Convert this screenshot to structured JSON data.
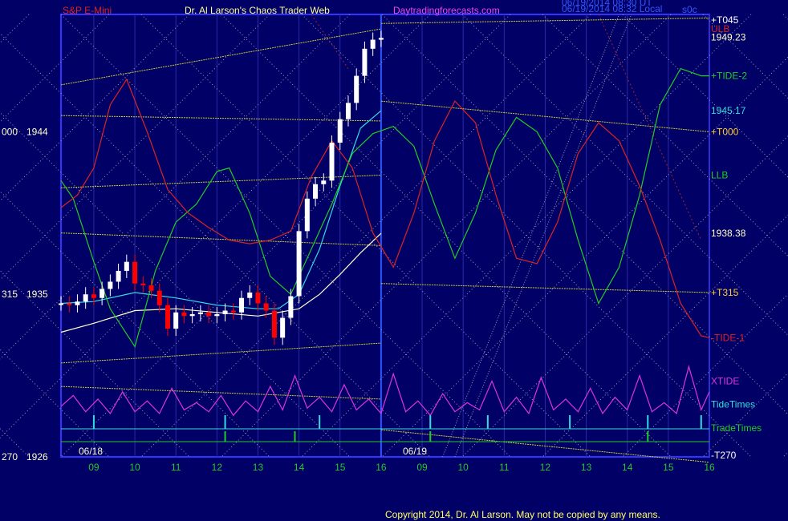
{
  "header": {
    "instrument": "S&P E-Mini",
    "site_title": "Dr. Al Larson's Chaos Trader Web",
    "site_url": "Daytradingforecasts.com",
    "timestamp_1": "06/19/2014 08:30 UT",
    "timestamp_2": "06/19/2014 08:32 Local",
    "corner_label": "s0c"
  },
  "footer": {
    "copyright": "Copyright 2014, Dr. Al Larson. May not be copied by any means."
  },
  "colors": {
    "background": "#000066",
    "plot_border": "#3333ff",
    "price_up": "#ffffff",
    "price_down": "#ff0000",
    "tide_pos": "#22cc22",
    "tide_neg": "#dd2222",
    "xtide": "#dd33dd",
    "tidetimes": "#33dddd",
    "tradetimes": "#22cc22",
    "channel": "#cccc33"
  },
  "chart_data": {
    "type": "line",
    "title": "S&P E-Mini",
    "ylim": [
      1926,
      1950.5
    ],
    "y_left_labels": [
      {
        "value": 1944,
        "text": "1944",
        "prefix": "000"
      },
      {
        "value": 1935,
        "text": "1935",
        "prefix": "315"
      },
      {
        "value": 1926,
        "text": "1926",
        "prefix": "270"
      }
    ],
    "date_labels": [
      "06/18",
      "06/19"
    ],
    "x_ticks": [
      "09",
      "10",
      "11",
      "12",
      "13",
      "14",
      "15",
      "16",
      "09",
      "10",
      "11",
      "12",
      "13",
      "14",
      "15",
      "16"
    ],
    "right_labels": [
      {
        "text": "+T045",
        "value": 1950.2,
        "color": "#ffffff"
      },
      {
        "text": "ULB",
        "value": 1949.7,
        "color": "#dd2222"
      },
      {
        "text": "1949.23",
        "value": 1949.23,
        "color": "#ffffcc"
      },
      {
        "text": "+TIDE-2",
        "value": 1947.1,
        "color": "#22cc22"
      },
      {
        "text": "1945.17",
        "value": 1945.17,
        "color": "#33dddd"
      },
      {
        "text": "+T000",
        "value": 1944.0,
        "color": "#ffcc33"
      },
      {
        "text": "LLB",
        "value": 1941.6,
        "color": "#22cc22"
      },
      {
        "text": "1938.38",
        "value": 1938.38,
        "color": "#ffffcc"
      },
      {
        "text": "+T315",
        "value": 1935.1,
        "color": "#ffcc33"
      },
      {
        "text": "-TIDE-1",
        "value": 1932.6,
        "color": "#dd2222"
      },
      {
        "text": "XTIDE",
        "value": 1930.2,
        "color": "#dd33dd"
      },
      {
        "text": "TideTimes",
        "value": 1928.9,
        "color": "#33dddd"
      },
      {
        "text": "TradeTimes",
        "value": 1927.6,
        "color": "#22cc22"
      },
      {
        "text": "-T270",
        "value": 1926.0,
        "color": "#ffffff"
      }
    ],
    "series": [
      {
        "name": "S&P E-Mini",
        "color": "#ffffff",
        "down_color": "#ff0000",
        "x": [
          8.2,
          8.4,
          8.6,
          8.8,
          9.0,
          9.2,
          9.4,
          9.6,
          9.8,
          10.0,
          10.2,
          10.4,
          10.6,
          10.8,
          11.0,
          11.2,
          11.4,
          11.6,
          11.8,
          12.0,
          12.2,
          12.4,
          12.6,
          12.8,
          13.0,
          13.2,
          13.4,
          13.6,
          13.8,
          14.0,
          14.2,
          14.4,
          14.6,
          14.8,
          15.0,
          15.2,
          15.4,
          15.6,
          15.8,
          16.0
        ],
        "values": [
          1934.5,
          1934.4,
          1934.6,
          1935.0,
          1934.8,
          1935.3,
          1935.7,
          1936.3,
          1936.8,
          1935.6,
          1935.5,
          1935.2,
          1934.4,
          1933.1,
          1934.0,
          1933.8,
          1933.9,
          1934.0,
          1933.8,
          1933.9,
          1934.1,
          1934.0,
          1934.8,
          1935.1,
          1934.5,
          1934.1,
          1932.6,
          1933.7,
          1934.9,
          1938.5,
          1940.3,
          1941.1,
          1941.3,
          1943.4,
          1944.7,
          1945.6,
          1947.1,
          1948.6,
          1949.1,
          1949.2
        ]
      },
      {
        "name": "Moving average 1",
        "color": "#33dddd",
        "x": [
          8.2,
          9.0,
          10.0,
          11.0,
          12.0,
          13.0,
          13.5,
          14.0,
          14.5,
          15.0,
          15.5,
          16.0
        ],
        "values": [
          1934.5,
          1934.6,
          1935.1,
          1934.8,
          1934.4,
          1934.2,
          1934.2,
          1935.0,
          1937.5,
          1941.0,
          1944.2,
          1945.17
        ]
      },
      {
        "name": "Moving average 2",
        "color": "#ffffcc",
        "x": [
          8.2,
          9.0,
          10.0,
          11.0,
          12.0,
          13.0,
          14.0,
          14.5,
          15.0,
          15.5,
          16.0
        ],
        "values": [
          1932.9,
          1933.4,
          1934.1,
          1934.2,
          1934.0,
          1933.8,
          1934.2,
          1935.0,
          1936.1,
          1937.3,
          1938.38
        ]
      },
      {
        "name": "+TIDE-2",
        "color": "#22cc22",
        "x": [
          8.2,
          8.5,
          9.0,
          9.4,
          10.0,
          10.5,
          11.0,
          11.5,
          12.0,
          12.3,
          12.8,
          13.3,
          13.8,
          14.3,
          14.8,
          15.3,
          15.8,
          16.3,
          16.8,
          17.3,
          17.8,
          18.3,
          18.8,
          19.3,
          19.8,
          20.3,
          20.8,
          21.3,
          21.8,
          22.3,
          22.8,
          23.3,
          23.8,
          24.0
        ],
        "values": [
          1941.3,
          1940.3,
          1936.8,
          1934.2,
          1932.1,
          1936.3,
          1939.0,
          1940.0,
          1941.8,
          1942.0,
          1939.5,
          1936.0,
          1935.0,
          1937.5,
          1940.0,
          1942.8,
          1943.9,
          1944.3,
          1943.2,
          1940.0,
          1937.0,
          1939.5,
          1943.0,
          1944.8,
          1944.0,
          1942.0,
          1938.0,
          1934.5,
          1936.5,
          1940.5,
          1945.5,
          1947.5,
          1947.1,
          1947.1
        ]
      },
      {
        "name": "-TIDE-1",
        "color": "#dd2222",
        "x": [
          8.2,
          8.6,
          9.0,
          9.4,
          9.8,
          10.3,
          10.8,
          11.3,
          11.8,
          12.3,
          12.8,
          13.3,
          13.8,
          14.3,
          14.8,
          15.3,
          15.8,
          16.3,
          16.8,
          17.3,
          17.8,
          18.3,
          18.8,
          19.3,
          19.8,
          20.3,
          20.8,
          21.3,
          21.8,
          22.3,
          22.8,
          23.3,
          23.8,
          24.0
        ],
        "values": [
          1939.8,
          1940.5,
          1942.0,
          1945.5,
          1946.9,
          1944.0,
          1940.8,
          1939.5,
          1938.7,
          1938.0,
          1937.8,
          1938.0,
          1938.5,
          1941.5,
          1943.5,
          1942.0,
          1938.4,
          1936.5,
          1939.5,
          1943.5,
          1945.7,
          1944.5,
          1940.5,
          1937.0,
          1936.7,
          1939.0,
          1942.8,
          1944.5,
          1943.5,
          1941.0,
          1938.0,
          1934.5,
          1932.7,
          1932.6
        ]
      },
      {
        "name": "XTIDE",
        "color": "#dd33dd",
        "x": [
          8.2,
          8.5,
          8.8,
          9.1,
          9.4,
          9.7,
          10.0,
          10.3,
          10.6,
          10.9,
          11.2,
          11.5,
          11.8,
          12.1,
          12.4,
          12.7,
          13.0,
          13.3,
          13.6,
          13.9,
          14.2,
          14.5,
          14.8,
          15.1,
          15.4,
          15.7,
          16.0,
          16.3,
          16.6,
          16.9,
          17.2,
          17.5,
          17.8,
          18.1,
          18.4,
          18.7,
          19.0,
          19.3,
          19.6,
          19.9,
          20.2,
          20.5,
          20.8,
          21.1,
          21.4,
          21.7,
          22.0,
          22.3,
          22.6,
          22.9,
          23.2,
          23.5,
          23.8,
          24.0
        ],
        "values": [
          1928.8,
          1929.4,
          1928.5,
          1929.2,
          1928.4,
          1929.6,
          1928.5,
          1929.1,
          1928.4,
          1929.8,
          1928.6,
          1929.0,
          1928.5,
          1929.4,
          1928.3,
          1929.1,
          1928.5,
          1929.9,
          1928.6,
          1930.5,
          1928.7,
          1929.3,
          1928.5,
          1930.0,
          1928.6,
          1929.2,
          1928.4,
          1930.6,
          1928.5,
          1929.1,
          1928.3,
          1929.5,
          1928.5,
          1929.0,
          1928.6,
          1930.2,
          1928.5,
          1929.3,
          1928.4,
          1930.4,
          1928.6,
          1929.2,
          1928.5,
          1929.8,
          1928.4,
          1929.3,
          1928.6,
          1930.5,
          1928.5,
          1929.0,
          1928.4,
          1931.0,
          1928.6,
          1929.6
        ]
      }
    ],
    "channel_lines": [
      {
        "x": [
          8.2,
          16.0
        ],
        "values": [
          1946.6,
          1949.7
        ]
      },
      {
        "x": [
          8.2,
          16.0
        ],
        "values": [
          1944.9,
          1944.6
        ]
      },
      {
        "x": [
          8.2,
          16.0
        ],
        "values": [
          1940.9,
          1941.6
        ]
      },
      {
        "x": [
          8.2,
          16.0
        ],
        "values": [
          1938.4,
          1937.7
        ]
      },
      {
        "x": [
          8.2,
          16.0
        ],
        "values": [
          1931.2,
          1932.3
        ]
      },
      {
        "x": [
          8.2,
          16.0
        ],
        "values": [
          1929.9,
          1929.2
        ]
      },
      {
        "x": [
          16.0,
          24.0
        ],
        "values": [
          1950.0,
          1950.3
        ]
      },
      {
        "x": [
          16.0,
          24.0
        ],
        "values": [
          1945.7,
          1944.0
        ]
      },
      {
        "x": [
          16.0,
          24.0
        ],
        "values": [
          1935.6,
          1935.1
        ]
      },
      {
        "x": [
          16.0,
          24.0
        ],
        "values": [
          1927.5,
          1925.7
        ]
      }
    ],
    "grid": true,
    "legend": "right"
  }
}
